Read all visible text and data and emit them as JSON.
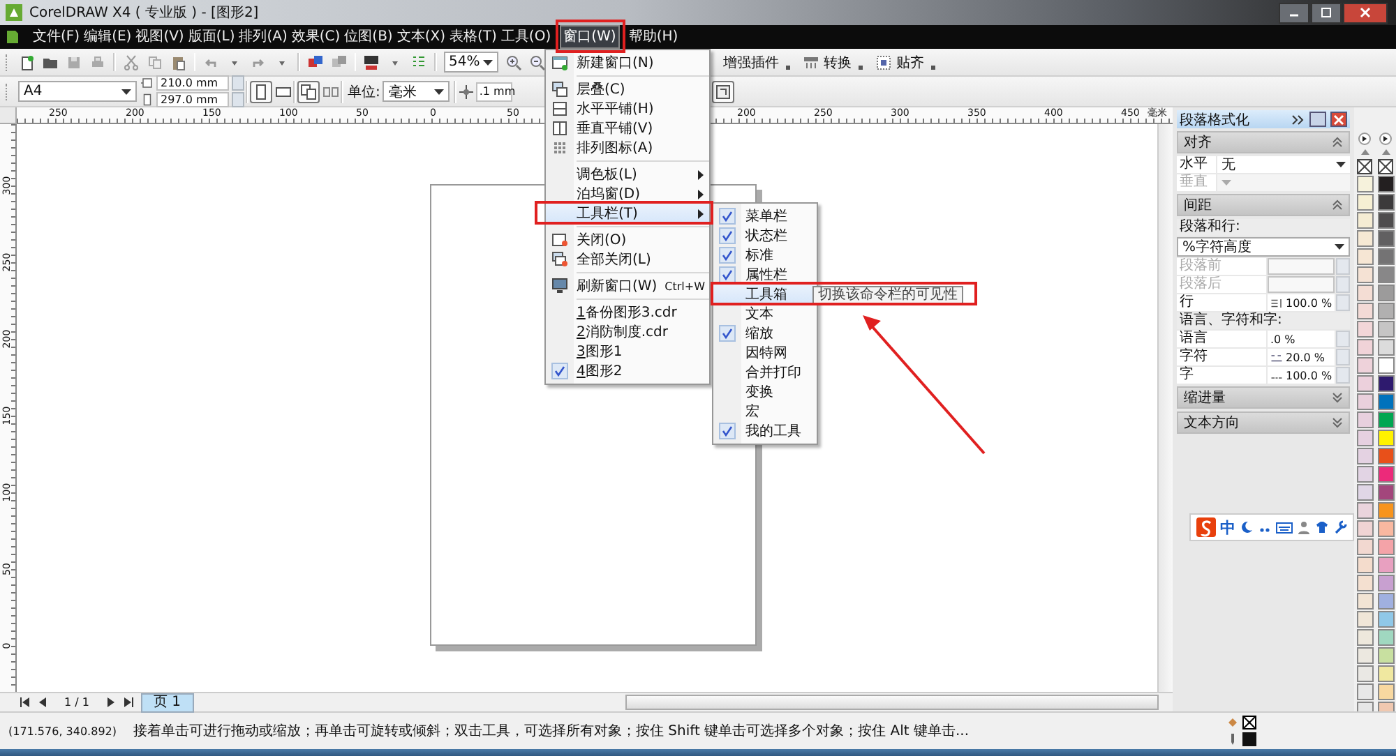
{
  "window": {
    "title": "CorelDRAW X4 ( 专业版 ) - [图形2]"
  },
  "menu_bar": [
    {
      "label": "文件(F)",
      "selected": false
    },
    {
      "label": "编辑(E)",
      "selected": false
    },
    {
      "label": "视图(V)",
      "selected": false
    },
    {
      "label": "版面(L)",
      "selected": false
    },
    {
      "label": "排列(A)",
      "selected": false
    },
    {
      "label": "效果(C)",
      "selected": false
    },
    {
      "label": "位图(B)",
      "selected": false
    },
    {
      "label": "文本(X)",
      "selected": false
    },
    {
      "label": "表格(T)",
      "selected": false
    },
    {
      "label": "工具(O)",
      "selected": false
    },
    {
      "label": "窗口(W)",
      "selected": true
    },
    {
      "label": "帮助(H)",
      "selected": false
    }
  ],
  "standard_toolbar": {
    "zoom": "54%",
    "plugins": [
      {
        "label": "增强插件"
      },
      {
        "label": "转换"
      },
      {
        "label": "贴齐"
      }
    ]
  },
  "property_bar": {
    "paper": "A4",
    "width": "210.0 mm",
    "height": "297.0 mm",
    "units_label": "单位:",
    "units": "毫米",
    "nudge": ".1 mm"
  },
  "horizontal_ruler": {
    "ticks": [
      "250",
      "200",
      "150",
      "100",
      "50",
      "0",
      "50",
      "200",
      "250",
      "300",
      "350",
      "400",
      "450"
    ],
    "unit": "毫米"
  },
  "vertical_ruler": {
    "ticks": [
      "300",
      "250",
      "200",
      "150",
      "100",
      "50",
      "0"
    ]
  },
  "window_menu": [
    {
      "kind": "command",
      "label": "新建窗口(N)",
      "selected": false
    },
    {
      "kind": "separator"
    },
    {
      "kind": "command",
      "label": "层叠(C)",
      "selected": false
    },
    {
      "kind": "command",
      "label": "水平平铺(H)",
      "selected": false
    },
    {
      "kind": "command",
      "label": "垂直平铺(V)",
      "selected": false
    },
    {
      "kind": "command",
      "label": "排列图标(A)",
      "selected": false
    },
    {
      "kind": "separator"
    },
    {
      "kind": "submenu",
      "label": "调色板(L)",
      "selected": false
    },
    {
      "kind": "submenu",
      "label": "泊坞窗(D)",
      "selected": false
    },
    {
      "kind": "submenu",
      "label": "工具栏(T)",
      "selected": true
    },
    {
      "kind": "separator"
    },
    {
      "kind": "command",
      "label": "关闭(O)",
      "selected": false
    },
    {
      "kind": "command",
      "label": "全部关闭(L)",
      "selected": false
    },
    {
      "kind": "separator"
    },
    {
      "kind": "command",
      "label": "刷新窗口(W)",
      "shortcut": "Ctrl+W",
      "selected": false
    },
    {
      "kind": "separator"
    },
    {
      "kind": "recent",
      "number": "1",
      "label": "备份图形3.cdr",
      "checked": false,
      "selected": false
    },
    {
      "kind": "recent",
      "number": "2",
      "label": "消防制度.cdr",
      "checked": false,
      "selected": false
    },
    {
      "kind": "recent",
      "number": "3",
      "label": "图形1",
      "checked": false,
      "selected": false
    },
    {
      "kind": "recent",
      "number": "4",
      "label": "图形2",
      "checked": true,
      "selected": false
    }
  ],
  "toolbar_submenu": [
    {
      "label": "菜单栏",
      "checked": true,
      "selected": false
    },
    {
      "label": "状态栏",
      "checked": true,
      "selected": false
    },
    {
      "label": "标准",
      "checked": true,
      "selected": false
    },
    {
      "label": "属性栏",
      "checked": true,
      "selected": false
    },
    {
      "label": "工具箱",
      "checked": false,
      "selected": true
    },
    {
      "label": "文本",
      "checked": false,
      "selected": false
    },
    {
      "label": "缩放",
      "checked": true,
      "selected": false
    },
    {
      "label": "因特网",
      "checked": false,
      "selected": false
    },
    {
      "label": "合并打印",
      "checked": false,
      "selected": false
    },
    {
      "label": "变换",
      "checked": false,
      "selected": false
    },
    {
      "label": "宏",
      "checked": false,
      "selected": false
    },
    {
      "label": "我的工具",
      "checked": true,
      "selected": false
    }
  ],
  "tooltip": "切换该命令栏的可见性",
  "docker": {
    "title": "段落格式化",
    "sections": [
      {
        "title": "对齐",
        "expanded": true,
        "rows": [
          {
            "kind": "combo",
            "label": "水平",
            "value": "无",
            "disabled": false
          },
          {
            "kind": "combo",
            "label": "垂直",
            "disabled": true
          }
        ]
      },
      {
        "title": "间距",
        "expanded": true,
        "rows": [
          {
            "kind": "caption",
            "label": "段落和行:"
          },
          {
            "kind": "dropdown",
            "value": "%字符高度"
          },
          {
            "kind": "spin",
            "label": "段落前",
            "disabled": true
          },
          {
            "kind": "spin",
            "label": "段落后",
            "disabled": true
          },
          {
            "kind": "spin",
            "label": "行",
            "value": "100.0 %",
            "disabled": false
          },
          {
            "kind": "caption",
            "label": "语言、字符和字:"
          },
          {
            "kind": "spin",
            "label": "语言",
            "value": ".0 %",
            "disabled": false
          },
          {
            "kind": "spin",
            "label": "字符",
            "value": "20.0 %",
            "disabled": false
          },
          {
            "kind": "spin",
            "label": "字",
            "value": "100.0 %",
            "disabled": false
          }
        ]
      },
      {
        "title": "缩进量",
        "expanded": false
      },
      {
        "title": "文本方向",
        "expanded": false
      }
    ]
  },
  "palette": [
    [
      {
        "color": "#f6f2dc"
      },
      {
        "color": "#f6efd3"
      },
      {
        "color": "#f5ecd3"
      },
      {
        "color": "#f6e9d4"
      },
      {
        "color": "#f6e6d4"
      },
      {
        "color": "#f5e2d4"
      },
      {
        "color": "#f4ddd4"
      },
      {
        "color": "#f3dad6"
      },
      {
        "color": "#f2d6d8"
      },
      {
        "color": "#f0d3d8"
      },
      {
        "color": "#eed2da"
      },
      {
        "color": "#ecd0dc"
      },
      {
        "color": "#ead0dc"
      },
      {
        "color": "#e8d0de"
      },
      {
        "color": "#e6d0e0"
      },
      {
        "color": "#e4d2e2"
      },
      {
        "color": "#e2d4e4"
      },
      {
        "color": "#e0d6e6"
      },
      {
        "color": "#ead4dc"
      },
      {
        "color": "#f0d4d4"
      },
      {
        "color": "#f2d8d0"
      },
      {
        "color": "#f4dccc"
      },
      {
        "color": "#f4e0d0"
      },
      {
        "color": "#f2e4d4"
      },
      {
        "color": "#f0e6d8"
      },
      {
        "color": "#eee8dc"
      },
      {
        "color": "#ece8e0"
      },
      {
        "color": "#eae8e4"
      },
      {
        "color": "#e8e8e8"
      },
      {
        "color": "#e6e6e6"
      }
    ],
    [
      {
        "color": "#231f20"
      },
      {
        "color": "#3c3a3b"
      },
      {
        "color": "#4e4c4d"
      },
      {
        "color": "#616061"
      },
      {
        "color": "#747374"
      },
      {
        "color": "#888788"
      },
      {
        "color": "#9c9b9b"
      },
      {
        "color": "#b1b0b0"
      },
      {
        "color": "#c6c5c5"
      },
      {
        "color": "#dcdcdc"
      },
      {
        "color": "#ffffff"
      },
      {
        "color": "#2e1a6e"
      },
      {
        "color": "#0072bc"
      },
      {
        "color": "#00a651"
      },
      {
        "color": "#fff200"
      },
      {
        "color": "#e8501a"
      },
      {
        "color": "#ec2a7a"
      },
      {
        "color": "#a3467c"
      },
      {
        "color": "#f7941d"
      },
      {
        "color": "#f9b8a0"
      },
      {
        "color": "#f4a3a8"
      },
      {
        "color": "#e8a0c0"
      },
      {
        "color": "#c8a0d0"
      },
      {
        "color": "#a0b0e0"
      },
      {
        "color": "#90c8e8"
      },
      {
        "color": "#a0d8c0"
      },
      {
        "color": "#c8e0a0"
      },
      {
        "color": "#f0e8a0"
      },
      {
        "color": "#f8d8a0"
      },
      {
        "color": "#f0c8b0"
      }
    ]
  ],
  "ime_bar": {
    "label": "中"
  },
  "page_nav": {
    "count": "1 / 1",
    "tabs": [
      {
        "label": "页 1",
        "selected": true
      }
    ]
  },
  "status_bar": {
    "coords": "(171.576, 340.892)",
    "message": "接着单击可进行拖动或缩放；再单击可旋转或倾斜；双击工具，可选择所有对象；按住 Shift 键单击可选择多个对象；按住 Alt 键单击..."
  }
}
